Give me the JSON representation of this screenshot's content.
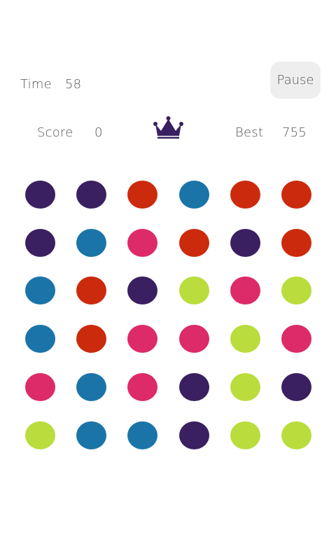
{
  "header": {
    "time_label": "Time",
    "time_value": "58",
    "pause_label": "Pause",
    "score_label": "Score",
    "score_value": "0",
    "best_label": "Best",
    "best_value": "755",
    "crown_icon": "crown-icon"
  },
  "colors": {
    "purple": "#3a2060",
    "blue": "#1a74a8",
    "red": "#cc2a0c",
    "pink": "#dd2a68",
    "green": "#b9dd3c",
    "pause_bg": "#eeeeee",
    "text": "#555555"
  },
  "board": {
    "rows": 6,
    "cols": 6,
    "grid": [
      [
        "purple",
        "purple",
        "red",
        "blue",
        "red",
        "red"
      ],
      [
        "purple",
        "blue",
        "pink",
        "red",
        "purple",
        "red"
      ],
      [
        "blue",
        "red",
        "purple",
        "green",
        "pink",
        "green"
      ],
      [
        "blue",
        "red",
        "pink",
        "pink",
        "green",
        "pink"
      ],
      [
        "pink",
        "blue",
        "pink",
        "purple",
        "green",
        "purple"
      ],
      [
        "green",
        "blue",
        "blue",
        "purple",
        "green",
        "green"
      ]
    ]
  }
}
